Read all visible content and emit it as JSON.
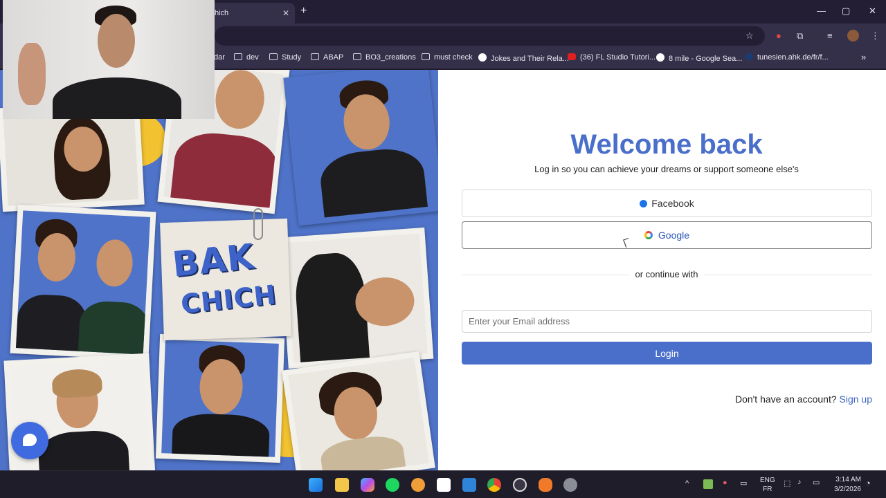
{
  "browser": {
    "tab_title": "hich",
    "tab_close": "✕",
    "new_tab": "+",
    "window_controls": {
      "minimize": "—",
      "maximize": "▢",
      "close": "✕"
    },
    "bookmarks": [
      {
        "label": "dar",
        "icon": "folder-icon"
      },
      {
        "label": "dev",
        "icon": "folder-icon"
      },
      {
        "label": "Study",
        "icon": "folder-icon"
      },
      {
        "label": "ABAP",
        "icon": "folder-icon"
      },
      {
        "label": "BO3_creations",
        "icon": "folder-icon"
      },
      {
        "label": "must check",
        "icon": "folder-icon"
      },
      {
        "label": "Jokes and Their Rela...",
        "icon": "google-icon"
      },
      {
        "label": "(36) FL Studio Tutori...",
        "icon": "youtube-icon"
      },
      {
        "label": "8 mile - Google Sea...",
        "icon": "google-icon"
      },
      {
        "label": "tunesien.ahk.de/fr/f...",
        "icon": "ahk-icon"
      }
    ],
    "bookmarks_overflow": "»"
  },
  "collage": {
    "logo_line1": "BAK",
    "logo_line2": "CHICH"
  },
  "login": {
    "title": "Welcome back",
    "subtitle": "Log in so you can achieve your dreams or support someone else's",
    "facebook_label": "Facebook",
    "google_label": "Google",
    "divider_label": "or continue with",
    "email_placeholder": "Enter your Email address",
    "login_label": "Login",
    "signup_prompt": "Don't have an account?",
    "signup_link": "Sign up"
  },
  "taskbar": {
    "language_line1": "ENG",
    "language_line2": "FR",
    "time": "3:14 AM",
    "date": "3/2/2026",
    "tray_chevron": "^"
  },
  "colors": {
    "brand_blue": "#4a6fca",
    "collage_blue": "#4f73c8",
    "accent_yellow": "#f2c230"
  }
}
